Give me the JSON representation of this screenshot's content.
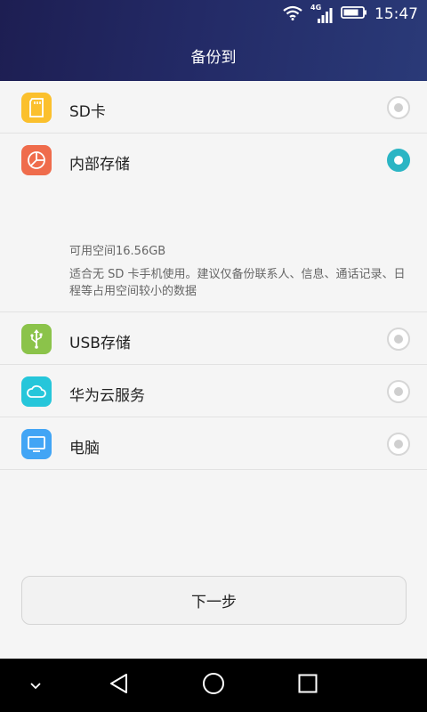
{
  "status_bar": {
    "network_label": "4G",
    "time": "15:47"
  },
  "header": {
    "title": "备份到"
  },
  "options": [
    {
      "label": "SD卡",
      "icon": "sd-card-icon",
      "color": "#fbc02d",
      "selected": false
    },
    {
      "label": "内部存储",
      "icon": "pie-chart-icon",
      "color": "#ef6c4c",
      "selected": true,
      "available_space": "可用空间16.56GB",
      "note": "适合无 SD 卡手机使用。建议仅备份联系人、信息、通话记录、日程等占用空间较小的数据"
    },
    {
      "label": "USB存储",
      "icon": "usb-icon",
      "color": "#8bc34a",
      "selected": false
    },
    {
      "label": "华为云服务",
      "icon": "cloud-icon",
      "color": "#26c6da",
      "selected": false
    },
    {
      "label": "电脑",
      "icon": "monitor-icon",
      "color": "#42a5f5",
      "selected": false
    }
  ],
  "buttons": {
    "next_label": "下一步"
  },
  "colors": {
    "accent": "#2bb5c4",
    "header_bg": "#1d1e52"
  }
}
